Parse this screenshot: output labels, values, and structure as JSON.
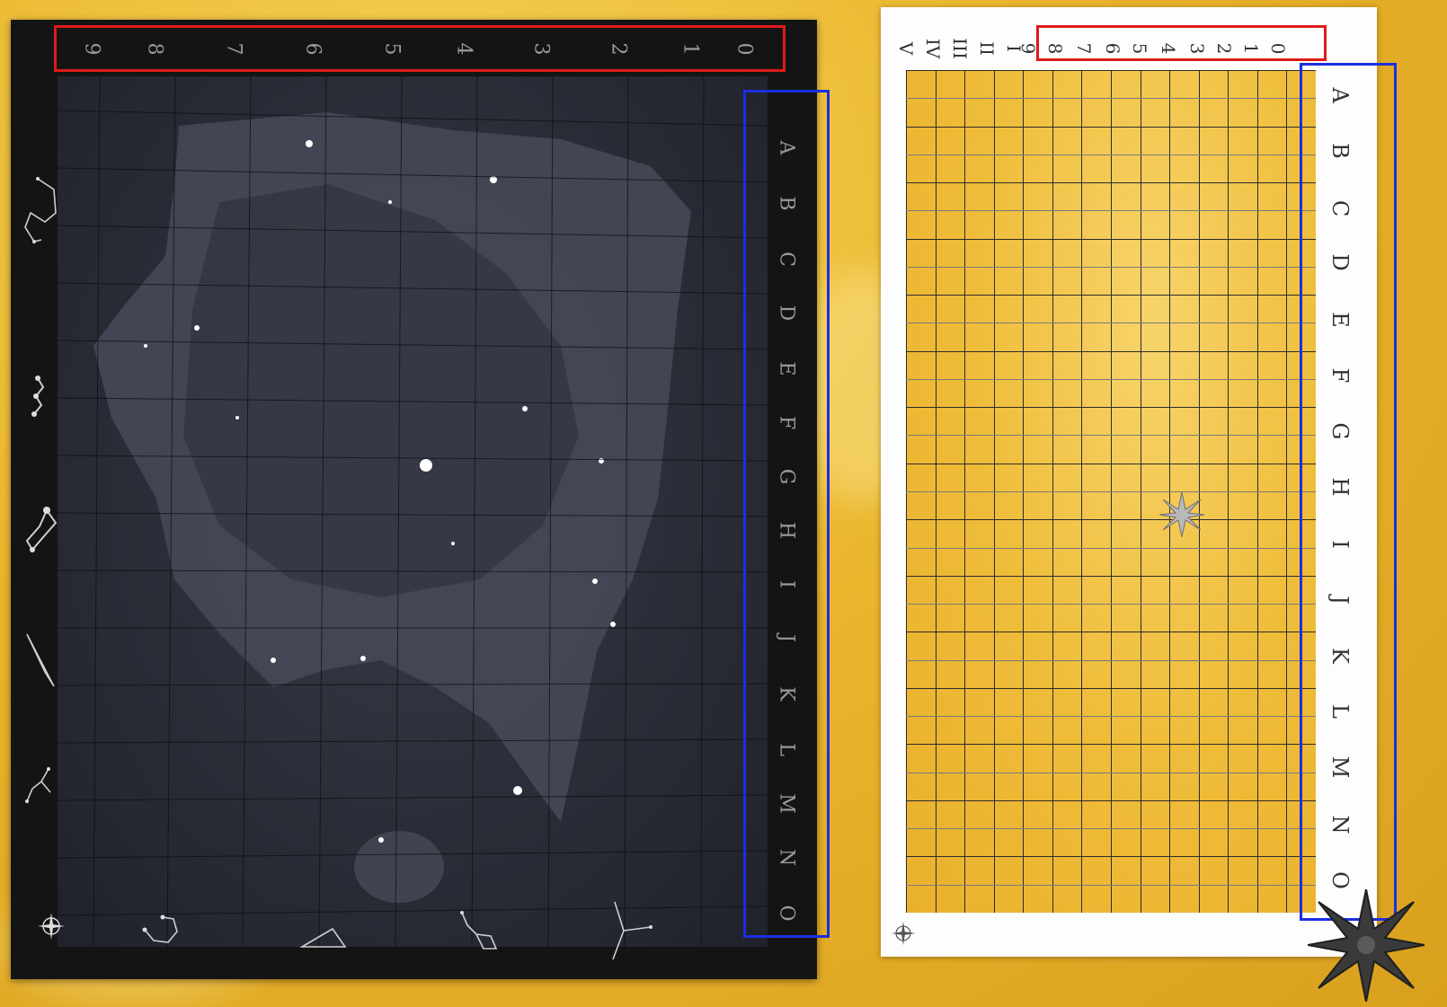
{
  "night_map": {
    "column_numbers": [
      "9",
      "8",
      "7",
      "6",
      "5",
      "4",
      "3",
      "2",
      "1",
      "0"
    ],
    "row_letters": [
      "A",
      "B",
      "C",
      "D",
      "E",
      "F",
      "G",
      "H",
      "I",
      "J",
      "K",
      "L",
      "M",
      "N",
      "O"
    ],
    "constellation_icons": [
      "constellation-hook-icon",
      "constellation-chain-icon",
      "constellation-cluster-icon",
      "constellation-wedge-icon",
      "constellation-branch-icon",
      "constellation-arc-icon",
      "constellation-triangle-icon",
      "constellation-dipper-icon",
      "constellation-fork-icon"
    ],
    "corner_icon": "compass-rose-icon"
  },
  "grid_map": {
    "column_numbers": [
      "0",
      "1",
      "2",
      "3",
      "4",
      "5",
      "6",
      "7",
      "8",
      "9"
    ],
    "row_numerals": [
      "I",
      "II",
      "III",
      "IV",
      "V"
    ],
    "row_letters": [
      "A",
      "B",
      "C",
      "D",
      "E",
      "F",
      "G",
      "H",
      "I",
      "J",
      "K",
      "L",
      "M",
      "N",
      "O"
    ],
    "center_icon": "star-marker-icon",
    "corner_icon": "compass-rose-icon",
    "corner_badge_icon": "large-star-badge-icon"
  },
  "colors": {
    "highlight_columns": "#e01a1a",
    "highlight_rows": "#1a2fe0",
    "night_background": "#141414",
    "parchment": "#efbd3a"
  }
}
